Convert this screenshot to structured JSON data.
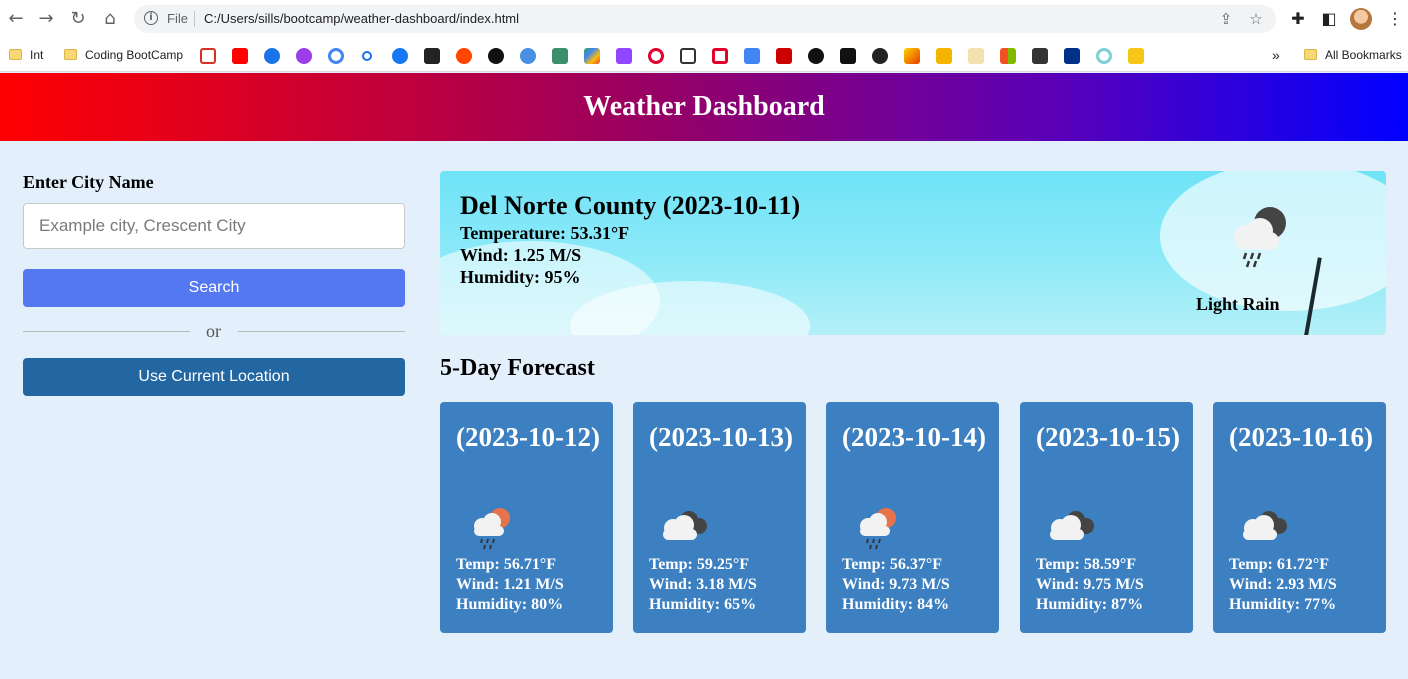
{
  "browser": {
    "url_scheme_label": "File",
    "url": "C:/Users/sills/bootcamp/weather-dashboard/index.html",
    "bookmarks": {
      "folder_int": "Int",
      "folder_coding": "Coding BootCamp",
      "more": "»",
      "all_bookmarks": "All Bookmarks"
    }
  },
  "header": {
    "title": "Weather Dashboard"
  },
  "search": {
    "label": "Enter City Name",
    "placeholder": "Example city, Crescent City",
    "value": "",
    "search_button": "Search",
    "or_text": "or",
    "location_button": "Use Current Location"
  },
  "current": {
    "title": "Del Norte County (2023-10-11)",
    "temperature": "Temperature: 53.31°F",
    "wind": "Wind: 1.25 M/S",
    "humidity": "Humidity: 95%",
    "description": "Light Rain",
    "icon": "rain-cloud-night-icon"
  },
  "forecast": {
    "title": "5-Day Forecast",
    "days": [
      {
        "date": "(2023-10-12)",
        "icon": "sun-cloud-rain-icon",
        "temp": "Temp: 56.71°F",
        "wind": "Wind: 1.21 M/S",
        "humidity": "Humidity: 80%"
      },
      {
        "date": "(2023-10-13)",
        "icon": "broken-clouds-icon",
        "temp": "Temp: 59.25°F",
        "wind": "Wind: 3.18 M/S",
        "humidity": "Humidity: 65%"
      },
      {
        "date": "(2023-10-14)",
        "icon": "sun-cloud-rain-icon",
        "temp": "Temp: 56.37°F",
        "wind": "Wind: 9.73 M/S",
        "humidity": "Humidity: 84%"
      },
      {
        "date": "(2023-10-15)",
        "icon": "broken-clouds-icon",
        "temp": "Temp: 58.59°F",
        "wind": "Wind: 9.75 M/S",
        "humidity": "Humidity: 87%"
      },
      {
        "date": "(2023-10-16)",
        "icon": "broken-clouds-icon",
        "temp": "Temp: 61.72°F",
        "wind": "Wind: 2.93 M/S",
        "humidity": "Humidity: 77%"
      }
    ]
  },
  "colors": {
    "header_gradient": [
      "#ff0000",
      "#9a0060",
      "#5a00b8",
      "#0000ff"
    ],
    "page_background": "#e3f0fb",
    "search_button": "#5478f0",
    "location_button": "#2266a2",
    "forecast_card": "#3d80c1"
  }
}
